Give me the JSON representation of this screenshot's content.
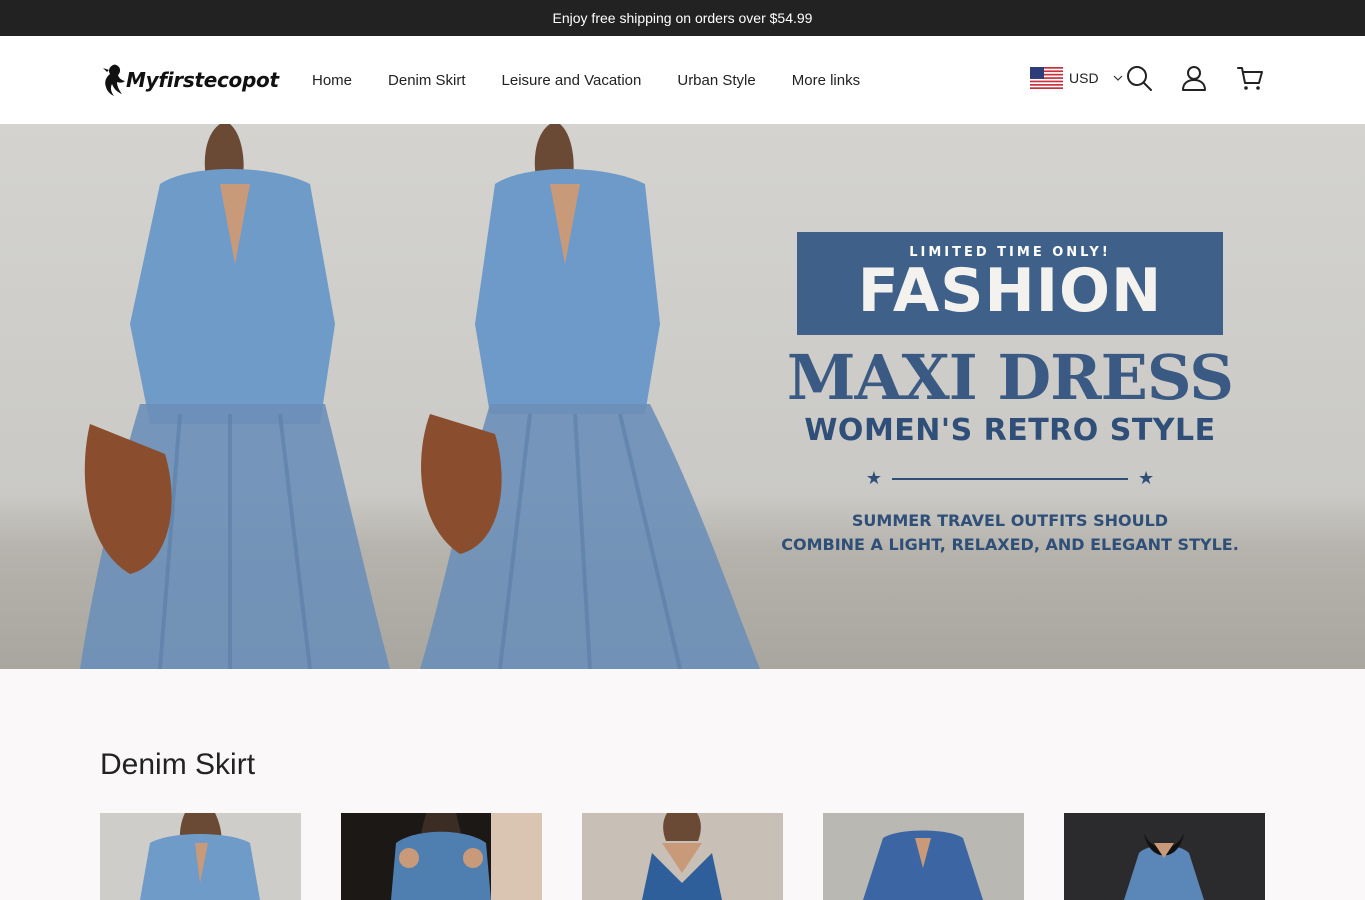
{
  "announcement": "Enjoy free shipping on orders over $54.99",
  "brand": {
    "name": "Myfirstecopot"
  },
  "nav": {
    "items": [
      {
        "label": "Home"
      },
      {
        "label": "Denim Skirt"
      },
      {
        "label": "Leisure and Vacation"
      },
      {
        "label": "Urban Style"
      },
      {
        "label": "More links"
      }
    ]
  },
  "header_actions": {
    "currency": "USD",
    "icons": [
      "search-icon",
      "account-icon",
      "cart-icon"
    ]
  },
  "hero": {
    "kicker": "LIMITED TIME ONLY!",
    "badge": "FASHION",
    "headline": "MAXI DRESS",
    "subheadline": "WOMEN'S RETRO STYLE",
    "description_line1": "SUMMER TRAVEL OUTFITS SHOULD",
    "description_line2": "COMBINE A LIGHT, RELAXED, AND ELEGANT STYLE."
  },
  "collection": {
    "title": "Denim Skirt",
    "products": [
      {
        "image": "denim-shirt-maxi-dress"
      },
      {
        "image": "cold-shoulder-denim-top"
      },
      {
        "image": "halter-denim-dress"
      },
      {
        "image": "denim-v-neck-blouse"
      },
      {
        "image": "ruffle-neck-denim-top"
      }
    ]
  },
  "colors": {
    "announcement_bg": "#222222",
    "accent_blue": "#3f6189",
    "text": "#222222",
    "page_bg": "#faf8f8"
  }
}
